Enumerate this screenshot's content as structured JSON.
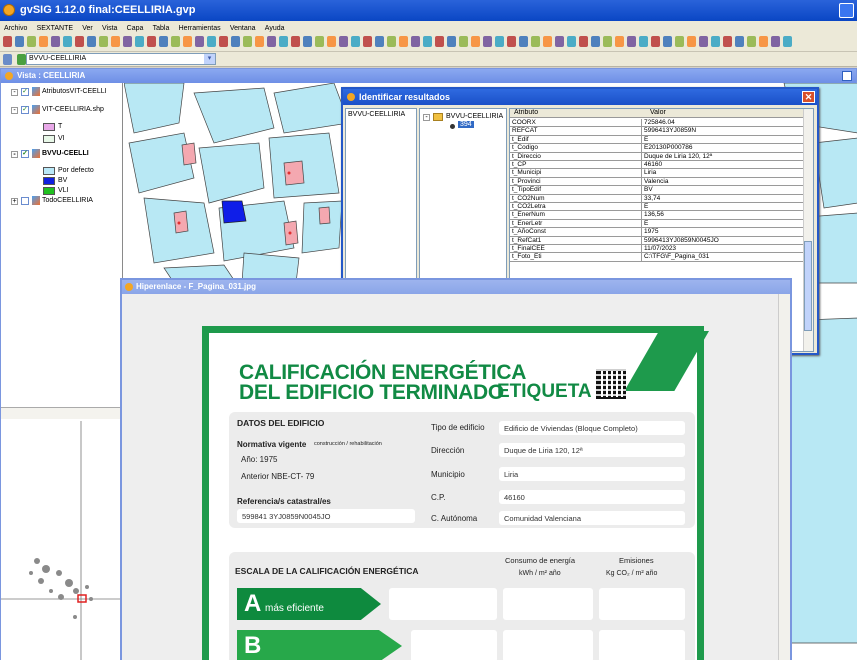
{
  "app": {
    "title": "gvSIG 1.12.0 final:CEELLIRIA.gvp"
  },
  "menu": [
    "Archivo",
    "SEXTANTE",
    "Ver",
    "Vista",
    "Capa",
    "Tabla",
    "Herramientas",
    "Ventana",
    "Ayuda"
  ],
  "toolbar2": {
    "layer_selected": "BVVU-CEELLIRIA"
  },
  "view": {
    "title": "Vista : CEELLIRIA",
    "toc": [
      {
        "label": "AtributosVIT-CEELLI",
        "checked": true
      },
      {
        "label": "VIT-CEELLIRIA.shp",
        "checked": true
      },
      {
        "label": "T",
        "color": "#e8a8e8"
      },
      {
        "label": "VI",
        "color": "#e8f8e8"
      },
      {
        "label": "BVVU-CEELLI",
        "checked": true
      },
      {
        "label": "Por defecto",
        "color": "#b8e8f8"
      },
      {
        "label": "BV",
        "color": "#1020e0"
      },
      {
        "label": "VLI",
        "color": "#20c020"
      },
      {
        "label": "TodoCEELLIRIA",
        "checked": false
      }
    ]
  },
  "identify": {
    "title": "Identificar resultados",
    "layer": "BVVU-CEELLIRIA",
    "tree_root": "BVVU-CEELLIRIA",
    "tree_child": "394",
    "col_attr": "Atributo",
    "col_val": "Valor",
    "rows": [
      [
        "COORX",
        "725846.04"
      ],
      [
        "REFCAT",
        "5996413YJ0859N"
      ],
      [
        "t_Edif",
        "E"
      ],
      [
        "t_Codigo",
        "E20130P000786"
      ],
      [
        "t_Direccio",
        "Duque de Liria 120, 12ª"
      ],
      [
        "t_CP",
        "46160"
      ],
      [
        "t_Municipi",
        "Liria"
      ],
      [
        "t_Provinci",
        "Valencia"
      ],
      [
        "t_TipoEdif",
        "BV"
      ],
      [
        "t_CO2Num",
        "33,74"
      ],
      [
        "t_CO2Letra",
        "E"
      ],
      [
        "t_EnerNum",
        "136,56"
      ],
      [
        "t_EnerLetr",
        "E"
      ],
      [
        "t_AñoConst",
        "1975"
      ],
      [
        "t_RefCat1",
        "5996413YJ0859N0045JO"
      ],
      [
        "t_FinalCEE",
        "11/07/2023"
      ],
      [
        "t_Foto_Eti",
        "C:\\TFG\\F_Pagina_031"
      ]
    ]
  },
  "hyperlink": {
    "title": "Hiperenlace - F_Pagina_031.jpg",
    "label": {
      "title1": "CALIFICACIÓN ENERGÉTICA",
      "title2": "DEL EDIFICIO TERMINADO",
      "etiqueta": "ETIQUETA",
      "datos_header": "DATOS DEL EDIFICIO",
      "normativa_label": "Normativa vigente",
      "normativa_sub": "construcción / rehabilitación",
      "anio": "Año: 1975",
      "anterior": "Anterior NBE-CT- 79",
      "refcat_label": "Referencia/s catastral/es",
      "refcat_value": "599841 3YJ0859N0045JO",
      "tipo_label": "Tipo de edificio",
      "tipo_value": "Edificio de Viviendas (Bloque Completo)",
      "direccion_label": "Dirección",
      "direccion_value": "Duque de Liria 120, 12ª",
      "municipio_label": "Municipio",
      "municipio_value": "Liria",
      "cp_label": "C.P.",
      "cp_value": "46160",
      "ca_label": "C. Autónoma",
      "ca_value": "Comunidad Valenciana",
      "escala_header": "ESCALA DE LA CALIFICACIÓN ENERGÉTICA",
      "consumo_label": "Consumo de energía",
      "consumo_unit": "kWh / m² año",
      "emisiones_label": "Emisiones",
      "emisiones_unit": "Kg CO₂ / m² año",
      "a_letter": "A",
      "a_text": "más eficiente",
      "b_letter": "B"
    }
  },
  "colors": {
    "title_blue": "#0a46c4",
    "label_green": "#1e9a4c",
    "parcel_fill": "#b8e8f4",
    "selected_parcel": "#0f1ee8",
    "pink_parcel": "#f4a8b0"
  }
}
